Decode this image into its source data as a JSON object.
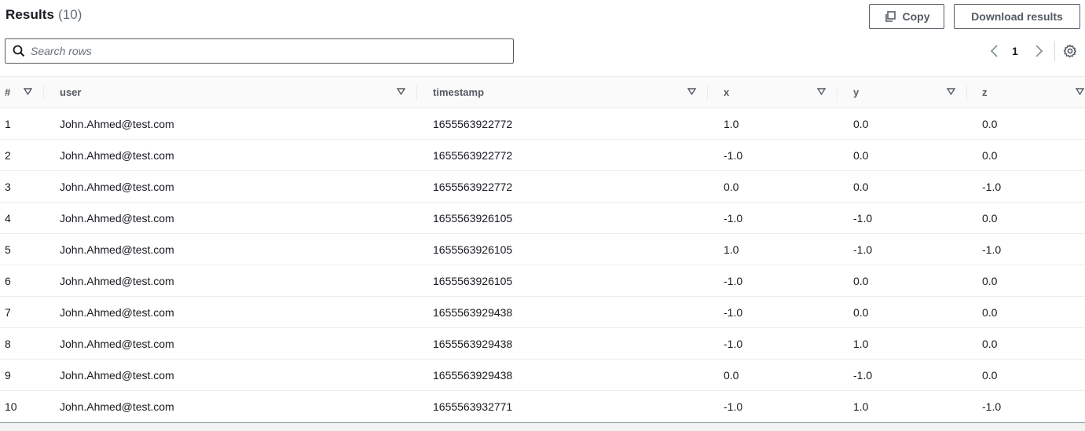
{
  "header": {
    "title": "Results",
    "count": "(10)",
    "copy_label": "Copy",
    "download_label": "Download results"
  },
  "search": {
    "placeholder": "Search rows",
    "value": ""
  },
  "pagination": {
    "current_page": "1"
  },
  "table": {
    "columns": [
      "#",
      "user",
      "timestamp",
      "x",
      "y",
      "z"
    ],
    "rows": [
      [
        "1",
        "John.Ahmed@test.com",
        "1655563922772",
        "1.0",
        "0.0",
        "0.0"
      ],
      [
        "2",
        "John.Ahmed@test.com",
        "1655563922772",
        "-1.0",
        "0.0",
        "0.0"
      ],
      [
        "3",
        "John.Ahmed@test.com",
        "1655563922772",
        "0.0",
        "0.0",
        "-1.0"
      ],
      [
        "4",
        "John.Ahmed@test.com",
        "1655563926105",
        "-1.0",
        "-1.0",
        "0.0"
      ],
      [
        "5",
        "John.Ahmed@test.com",
        "1655563926105",
        "1.0",
        "-1.0",
        "-1.0"
      ],
      [
        "6",
        "John.Ahmed@test.com",
        "1655563926105",
        "-1.0",
        "0.0",
        "0.0"
      ],
      [
        "7",
        "John.Ahmed@test.com",
        "1655563929438",
        "-1.0",
        "0.0",
        "0.0"
      ],
      [
        "8",
        "John.Ahmed@test.com",
        "1655563929438",
        "-1.0",
        "1.0",
        "0.0"
      ],
      [
        "9",
        "John.Ahmed@test.com",
        "1655563929438",
        "0.0",
        "-1.0",
        "0.0"
      ],
      [
        "10",
        "John.Ahmed@test.com",
        "1655563932771",
        "-1.0",
        "1.0",
        "-1.0"
      ]
    ]
  },
  "icons": {
    "copy": "copy-icon",
    "search": "search-icon",
    "prev": "chevron-left-icon",
    "next": "chevron-right-icon",
    "settings": "gear-icon",
    "sort": "caret-down-icon"
  },
  "colors": {
    "text": "#16191f",
    "muted": "#545b64",
    "border": "#eaeded",
    "header_bg": "#fafafa"
  }
}
